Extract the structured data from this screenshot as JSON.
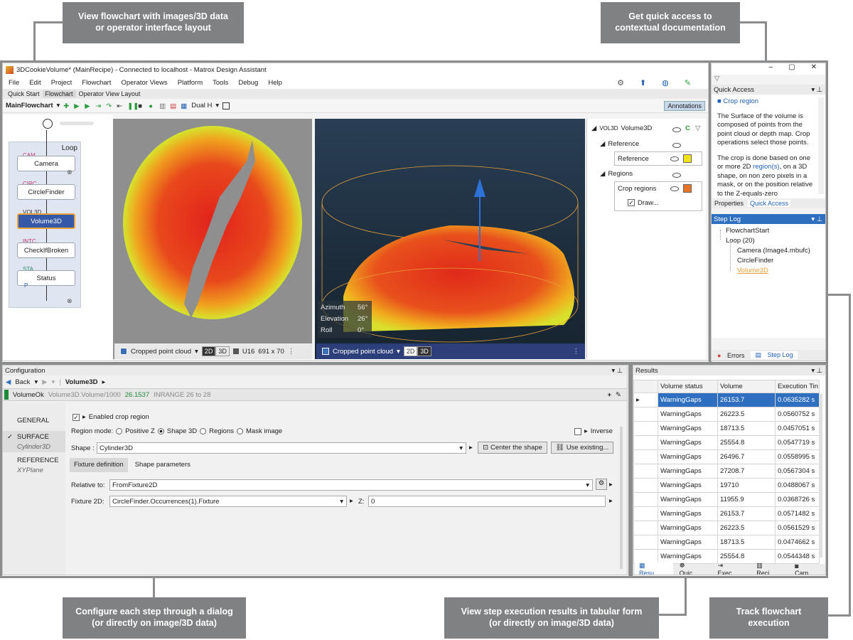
{
  "callouts": {
    "top_left": "View flowchart with images/3D data\nor operator interface layout",
    "top_right": "Get quick access to\ncontextual documentation",
    "bottom_left": "Configure each step through a dialog\n(or directly on image/3D data)",
    "bottom_mid": "View step execution results in tabular form\n(or directly on image/3D data)",
    "bottom_right": "Track flowchart\nexecution"
  },
  "window": {
    "title": "3DCookieVolume* (MainRecipe) - Connected to localhost - Matrox Design Assistant",
    "menu": [
      "File",
      "Edit",
      "Project",
      "Flowchart",
      "Operator Views",
      "Platform",
      "Tools",
      "Debug",
      "Help"
    ],
    "tabs": [
      "Quick Start",
      "Flowchart",
      "Operator View Layout"
    ],
    "toolbar": {
      "flow_name": "MainFlowchart",
      "layout": "Dual H",
      "annotations": "Annotations"
    }
  },
  "flowchart": {
    "loop_label": "Loop",
    "nodes": [
      {
        "tag": "CAM",
        "label": "Camera"
      },
      {
        "tag": "CIRC",
        "label": "CircleFinder"
      },
      {
        "tag": "VOL3D",
        "label": "Volume3D"
      },
      {
        "tag": "INTC",
        "label": "CheckIfBroken"
      },
      {
        "tag": "STA",
        "label": "Status"
      }
    ],
    "p_label": "P"
  },
  "view2d": {
    "source": "Cropped point cloud",
    "mode_2d": "2D",
    "mode_3d": "3D",
    "depth": "U16",
    "size": "691 x 70"
  },
  "view3d": {
    "source": "Cropped point cloud",
    "mode_2d": "2D",
    "mode_3d": "3D",
    "readout": [
      {
        "label": "Azimuth",
        "value": "56°"
      },
      {
        "label": "Elevation",
        "value": "26°"
      },
      {
        "label": "Roll",
        "value": "0°"
      }
    ]
  },
  "display_tree": {
    "root": "Volume3D",
    "root_tag": "VOL3D",
    "reference_group": "Reference",
    "reference_item": "Reference",
    "reference_color": "#f2e21a",
    "regions_group": "Regions",
    "crop_item": "Crop regions",
    "crop_color": "#e8742a",
    "draw_item": "Draw..."
  },
  "quick_access": {
    "header": "Quick Access",
    "topic": "Crop region",
    "para1": "The Surface of the volume is composed of points from the point cloud or depth map. Crop operations select those points.",
    "para2_pre": "The crop is done based on one or more 2D ",
    "para2_link": "region(s)",
    "para2_post": ", on a 3D shape, on non zero pixels in a mask, or on the position relative to the Z-equals-zero",
    "tab_properties": "Properties",
    "tab_quick": "Quick Access"
  },
  "step_log": {
    "header": "Step Log",
    "items": [
      "FlowchartStart",
      "Loop (20)",
      "Camera (Image4.mbufc)",
      "CircleFinder",
      "Volume3D"
    ],
    "tab_errors": "Errors",
    "tab_steplog": "Step Log"
  },
  "config": {
    "header": "Configuration",
    "back": "Back",
    "crumb": "Volume3D",
    "status": {
      "name": "VolumeOk",
      "expr": "Volume3D.Volume/1000",
      "value": "26.1537",
      "range": "INRANGE  26  to  28"
    },
    "nav": [
      "GENERAL",
      "SURFACE",
      "Cylinder3D",
      "REFERENCE",
      "XYPlane"
    ],
    "enabled_crop": "Enabled crop region",
    "region_mode_label": "Region mode:",
    "region_modes": [
      "Positive Z",
      "Shape 3D",
      "Regions",
      "Mask image"
    ],
    "inverse": "Inverse",
    "shape_label": "Shape :",
    "shape_value": "Cylinder3D",
    "center_btn": "Center the shape",
    "use_btn": "Use existing...",
    "subtabs": [
      "Fixture definition",
      "Shape parameters"
    ],
    "relative_label": "Relative to:",
    "relative_value": "FromFixture2D",
    "fixture_label": "Fixture 2D:",
    "fixture_value": "CircleFinder.Occurrences(1).Fixture",
    "z_label": "Z:",
    "z_value": "0"
  },
  "results": {
    "header": "Results",
    "columns": [
      "Volume status",
      "Volume",
      "Execution Tin"
    ],
    "rows": [
      [
        "WarningGaps",
        "26153.7",
        "0.0635282 s"
      ],
      [
        "WarningGaps",
        "26223.5",
        "0.0560752 s"
      ],
      [
        "WarningGaps",
        "18713.5",
        "0.0457051 s"
      ],
      [
        "WarningGaps",
        "25554.8",
        "0.0547719 s"
      ],
      [
        "WarningGaps",
        "26496.7",
        "0.0558995 s"
      ],
      [
        "WarningGaps",
        "27208.7",
        "0.0567304 s"
      ],
      [
        "WarningGaps",
        "19710",
        "0.0488067 s"
      ],
      [
        "WarningGaps",
        "11955.9",
        "0.0368726 s"
      ],
      [
        "WarningGaps",
        "26153.7",
        "0.0571482 s"
      ],
      [
        "WarningGaps",
        "26223.5",
        "0.0561529 s"
      ],
      [
        "WarningGaps",
        "18713.5",
        "0.0474662 s"
      ],
      [
        "WarningGaps",
        "25554.8",
        "0.0544348 s"
      ]
    ],
    "tabs": [
      "Resu...",
      "Quic...",
      "Exec...",
      "Reci...",
      "Cam..."
    ]
  }
}
